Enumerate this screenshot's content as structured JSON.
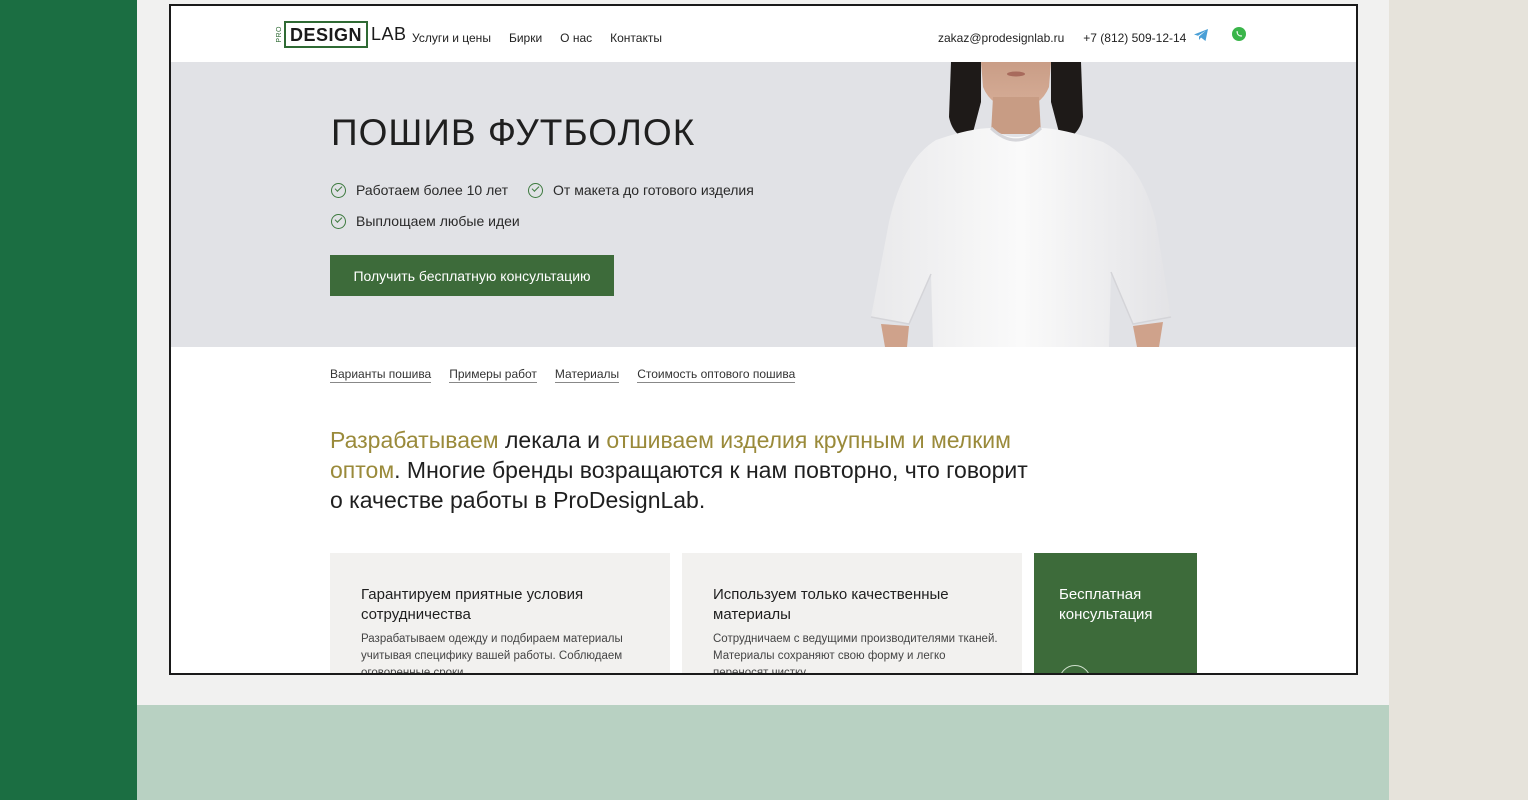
{
  "header": {
    "logo": {
      "pro": "PRO",
      "design": "DESIGN",
      "lab": "LAB"
    },
    "nav": [
      "Услуги и цены",
      "Бирки",
      "О нас",
      "Контакты"
    ],
    "email": "zakaz@prodesignlab.ru",
    "phone": "+7 (812) 509-12-14",
    "icons": [
      "telegram-icon",
      "whatsapp-icon"
    ]
  },
  "hero": {
    "title": "ПОШИВ ФУТБОЛОК",
    "features": [
      "Работаем более 10 лет",
      "От макета до готового изделия",
      "Выплощаем любые идеи"
    ],
    "cta": "Получить бесплатную консультацию"
  },
  "subnav": [
    "Варианты пошива",
    "Примеры работ",
    "Материалы",
    "Стоимость оптового пошива"
  ],
  "intro": {
    "part1": "Разрабатываем",
    "part2": " лекала и ",
    "part3": "отшиваем изделия крупным и мелким оптом",
    "part4": ". Многие бренды возращаются к нам повторно, что говорит о качестве работы в ProDesignLab."
  },
  "cards": [
    {
      "title": "Гарантируем приятные условия сотрудничества",
      "text": "Разрабатываем одежду и подбираем материалы учитывая специфику вашей работы. Соблюдаем оговоренные сроки"
    },
    {
      "title": "Используем только качественные материалы",
      "text": "Сотрудничаем с ведущими производителями тканей. Материалы сохраняют свою форму и легко переносят чистку"
    }
  ],
  "consult_card": {
    "title": "Бесплатная консультация"
  },
  "colors": {
    "accent": "#3d6b3a",
    "highlight": "#9a8a3a",
    "page_green": "#1b6e42",
    "mint": "#b8d1c2"
  }
}
